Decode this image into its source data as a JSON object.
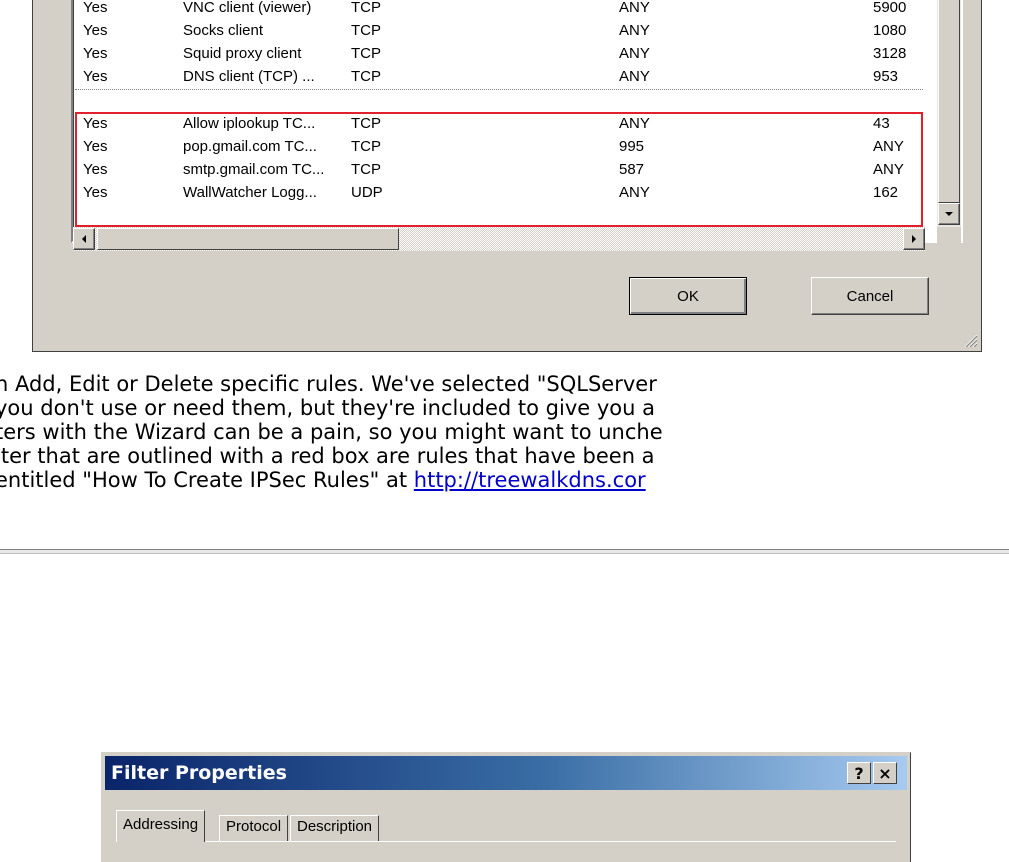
{
  "rules": {
    "rows": [
      [
        "Yes",
        "VNC client (viewer)",
        "TCP",
        "ANY",
        "5900"
      ],
      [
        "Yes",
        "Socks client",
        "TCP",
        "ANY",
        "1080"
      ],
      [
        "Yes",
        "Squid proxy client",
        "TCP",
        "ANY",
        "3128"
      ],
      [
        "Yes",
        "DNS client (TCP) ...",
        "TCP",
        "ANY",
        "953"
      ],
      [
        "Yes",
        "Allow iplookup TC...",
        "TCP",
        "ANY",
        "43"
      ],
      [
        "Yes",
        "pop.gmail.com TC...",
        "TCP",
        "995",
        "ANY"
      ],
      [
        "Yes",
        "smtp.gmail.com TC...",
        "TCP",
        "587",
        "ANY"
      ],
      [
        "Yes",
        "WallWatcher Logg...",
        "UDP",
        "ANY",
        "162"
      ]
    ],
    "highlight_color": "#e0202a"
  },
  "buttons": {
    "ok": "OK",
    "cancel": "Cancel"
  },
  "article": {
    "line1": "n Add, Edit or Delete specific rules. We've selected \"SQLServer",
    "line2": " you don't use or need them, but they're included to give you a",
    "line3": "ters with the Wizard can be a pain, so you might want to unche",
    "line4": "lter that are outlined with a red box are rules that have been a",
    "line5_text": "entitled \"How To Create IPSec Rules\" at ",
    "line5_link": "http://treewalkdns.cor"
  },
  "filter_dialog": {
    "title": "Filter Properties",
    "help_button": "?",
    "close_button": "×",
    "tabs": [
      "Addressing",
      "Protocol",
      "Description"
    ],
    "active_tab": "Addressing"
  }
}
